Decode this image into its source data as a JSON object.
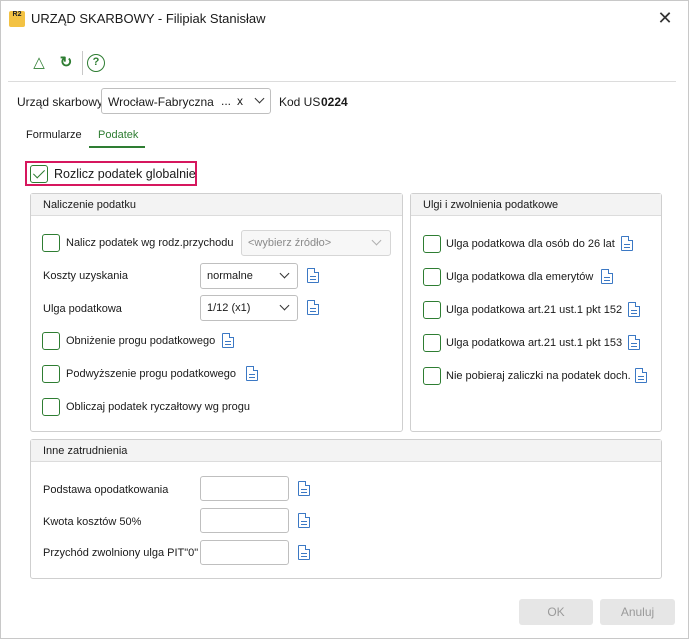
{
  "window": {
    "logo_text": "R2",
    "title": "URZĄD SKARBOWY - Filipiak Stanisław",
    "close_glyph": "✕"
  },
  "toolbar": {
    "icons": [
      "triangle-up-icon",
      "refresh-icon",
      "help-icon"
    ],
    "up_glyph": "△",
    "refresh_glyph": "↻",
    "help_glyph": "?"
  },
  "office": {
    "label": "Urząd skarbowy",
    "value": "Wrocław-Fabryczna",
    "more": "...",
    "clear": "x",
    "code_label": "Kod US",
    "code_value": "0224"
  },
  "tabs": [
    "Formularze",
    "Podatek"
  ],
  "active_tab": "Podatek",
  "global_tax": {
    "label": "Rozlicz podatek globalnie",
    "checked": true
  },
  "naliczenie": {
    "title": "Naliczenie podatku",
    "nalicz_label": "Nalicz podatek wg rodz.przychodu",
    "source_placeholder": "<wybierz źródło>",
    "koszty_label": "Koszty uzyskania",
    "koszty_value": "normalne",
    "ulga_label": "Ulga podatkowa",
    "ulga_value": "1/12 (x1)",
    "obnizenie_label": "Obniżenie progu podatkowego",
    "podwyzszenie_label": "Podwyższenie progu podatkowego",
    "ryczalt_label": "Obliczaj podatek ryczałtowy wg progu"
  },
  "ulgi": {
    "title": "Ulgi i zwolnienia podatkowe",
    "items": [
      "Ulga podatkowa dla osób do 26 lat",
      "Ulga podatkowa dla emerytów",
      "Ulga podatkowa art.21 ust.1 pkt 152",
      "Ulga podatkowa art.21 ust.1 pkt 153",
      "Nie pobieraj zaliczki na podatek doch."
    ]
  },
  "inne": {
    "title": "Inne zatrudnienia",
    "fields": [
      {
        "label": "Podstawa opodatkowania",
        "value": ""
      },
      {
        "label": "Kwota kosztów 50%",
        "value": ""
      },
      {
        "label": "Przychód zwolniony ulga PIT\"0\"",
        "value": ""
      }
    ]
  },
  "buttons": {
    "ok": "OK",
    "cancel": "Anuluj"
  },
  "colors": {
    "accent": "#2e7d32",
    "highlight": "#d6175e",
    "doc_icon": "#3b78c4"
  }
}
